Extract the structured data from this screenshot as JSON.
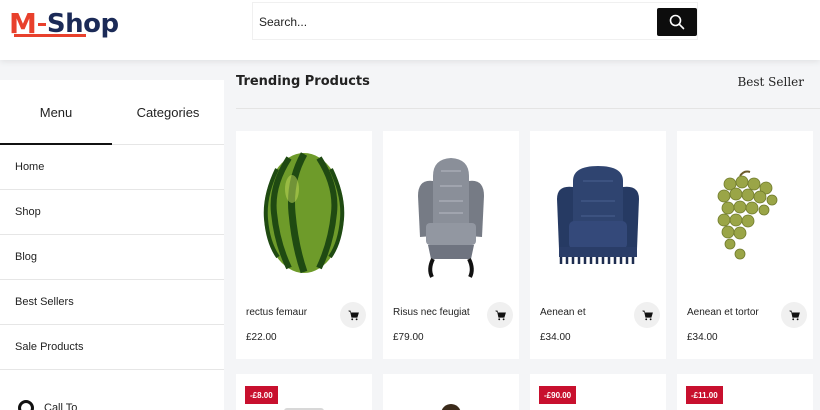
{
  "header": {
    "logo_m": "M",
    "logo_shop": "Shop",
    "search_placeholder": "Search...",
    "search_icon": "search-icon",
    "brand_red": "#e8402c",
    "brand_navy": "#1b2a57"
  },
  "sidebar": {
    "tabs": [
      {
        "label": "Menu",
        "active": true
      },
      {
        "label": "Categories",
        "active": false
      }
    ],
    "items": [
      {
        "label": "Home"
      },
      {
        "label": "Shop"
      },
      {
        "label": "Blog"
      },
      {
        "label": "Best Sellers"
      },
      {
        "label": "Sale Products"
      }
    ],
    "call_label": "Call To"
  },
  "main": {
    "title": "Trending Products",
    "filter_label": "Best Seller",
    "products": [
      {
        "name": "rectus femaur",
        "price": "£22.00",
        "image": "watermelon"
      },
      {
        "name": "Risus nec feugiat",
        "price": "£79.00",
        "image": "wingback-chair"
      },
      {
        "name": "Aenean et",
        "price": "£34.00",
        "image": "blue-armchair"
      },
      {
        "name": "Aenean et tortor",
        "price": "£34.00",
        "image": "grapes"
      }
    ],
    "second_row": [
      {
        "badge": "-£8.00"
      },
      {
        "badge": ""
      },
      {
        "badge": "-£90.00"
      },
      {
        "badge": "-£11.00"
      }
    ],
    "sale_badge_color": "#c8102e",
    "cart_icon": "cart-icon"
  }
}
